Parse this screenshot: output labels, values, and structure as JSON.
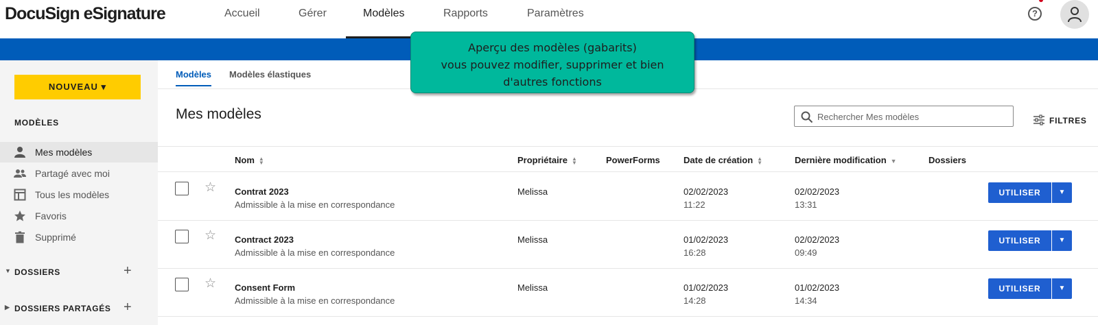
{
  "header": {
    "logo": "DocuSign eSignature",
    "nav": [
      {
        "label": "Accueil"
      },
      {
        "label": "Gérer"
      },
      {
        "label": "Modèles"
      },
      {
        "label": "Rapports"
      },
      {
        "label": "Paramètres"
      }
    ],
    "active_nav": "Modèles",
    "help_icon": "help-circle-icon",
    "profile_icon": "user-icon"
  },
  "colors": {
    "brand_blue": "#005cb9",
    "new_button": "#ffcc00",
    "use_button": "#1f5fd0",
    "callout": "#00b89c"
  },
  "sidebar": {
    "new_button_label": "NOUVEAU",
    "heading": "MODÈLES",
    "items": [
      {
        "label": "Mes modèles",
        "icon": "person-icon",
        "active": true
      },
      {
        "label": "Partagé avec moi",
        "icon": "people-icon"
      },
      {
        "label": "Tous les modèles",
        "icon": "template-icon"
      },
      {
        "label": "Favoris",
        "icon": "star-icon"
      },
      {
        "label": "Supprimé",
        "icon": "trash-icon"
      }
    ],
    "sections": [
      {
        "label": "DOSSIERS",
        "expanded": true
      },
      {
        "label": "DOSSIERS PARTAGÉS",
        "expanded": false
      }
    ]
  },
  "tabs": [
    {
      "label": "Modèles",
      "active": true
    },
    {
      "label": "Modèles élastiques"
    }
  ],
  "main": {
    "title": "Mes modèles",
    "search_placeholder": "Rechercher Mes modèles",
    "filters_label": "FILTRES"
  },
  "table": {
    "columns": [
      "Nom",
      "Propriétaire",
      "PowerForms",
      "Date de création",
      "Dernière modification",
      "Dossiers"
    ],
    "sorted_column": "Dernière modification",
    "sort_direction": "desc",
    "rows": [
      {
        "name": "Contrat 2023",
        "status": "Admissible à la mise en correspondance",
        "owner": "Melissa",
        "created_date": "02/02/2023",
        "created_time": "11:22",
        "modified_date": "02/02/2023",
        "modified_time": "13:31",
        "action": "UTILISER"
      },
      {
        "name": "Contract 2023",
        "status": "Admissible à la mise en correspondance",
        "owner": "Melissa",
        "created_date": "01/02/2023",
        "created_time": "16:28",
        "modified_date": "02/02/2023",
        "modified_time": "09:49",
        "action": "UTILISER"
      },
      {
        "name": "Consent Form",
        "status": "Admissible à la mise en correspondance",
        "owner": "Melissa",
        "created_date": "01/02/2023",
        "created_time": "14:28",
        "modified_date": "01/02/2023",
        "modified_time": "14:34",
        "action": "UTILISER"
      }
    ]
  },
  "callout": {
    "lines": [
      "Aperçu des modèles (gabarits)",
      "vous pouvez modifier, supprimer et bien",
      "d'autres fonctions"
    ]
  }
}
